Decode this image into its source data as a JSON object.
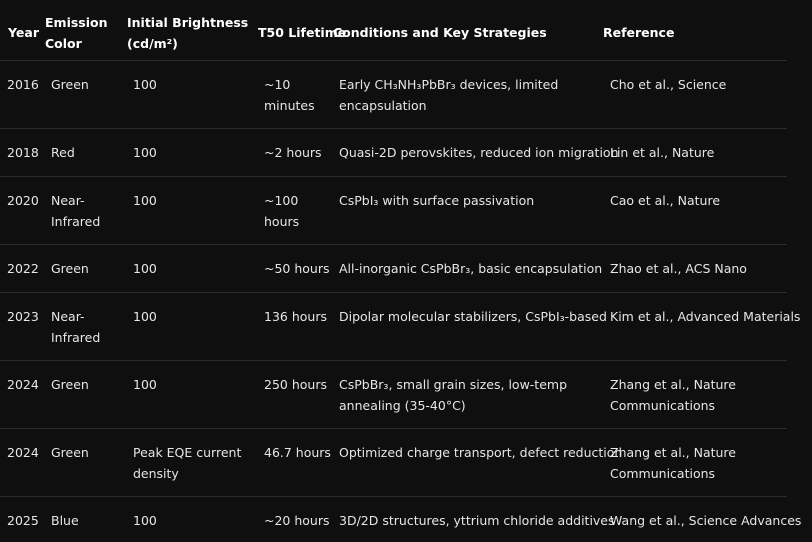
{
  "table": {
    "headers": {
      "year": "Year",
      "color": [
        "Emission",
        "Color"
      ],
      "brightness": [
        "Initial Brightness",
        "(cd/m²)"
      ],
      "t50": "T50 Lifetime",
      "conditions": "Conditions and Key Strategies",
      "reference": "Reference"
    },
    "rows": [
      {
        "year": "2016",
        "color": [
          "Green"
        ],
        "brightness": [
          "100"
        ],
        "t50": [
          "~10",
          "minutes"
        ],
        "conditions": [
          "Early CH₃NH₃PbBr₃ devices, limited",
          "encapsulation"
        ],
        "reference": [
          "Cho et al., Science"
        ]
      },
      {
        "year": "2018",
        "color": [
          "Red"
        ],
        "brightness": [
          "100"
        ],
        "t50": [
          "~2 hours"
        ],
        "conditions": [
          "Quasi-2D perovskites, reduced ion migration"
        ],
        "reference": [
          "Lin et al., Nature"
        ]
      },
      {
        "year": "2020",
        "color": [
          "Near-",
          "Infrared"
        ],
        "brightness": [
          "100"
        ],
        "t50": [
          "~100",
          "hours"
        ],
        "conditions": [
          "CsPbI₃ with surface passivation"
        ],
        "reference": [
          "Cao et al., Nature"
        ]
      },
      {
        "year": "2022",
        "color": [
          "Green"
        ],
        "brightness": [
          "100"
        ],
        "t50": [
          "~50 hours"
        ],
        "conditions": [
          "All-inorganic CsPbBr₃, basic encapsulation"
        ],
        "reference": [
          "Zhao et al., ACS Nano"
        ]
      },
      {
        "year": "2023",
        "color": [
          "Near-",
          "Infrared"
        ],
        "brightness": [
          "100"
        ],
        "t50": [
          "136 hours"
        ],
        "conditions": [
          "Dipolar molecular stabilizers, CsPbI₃-based"
        ],
        "reference": [
          "Kim et al., Advanced Materials"
        ]
      },
      {
        "year": "2024",
        "color": [
          "Green"
        ],
        "brightness": [
          "100"
        ],
        "t50": [
          "250 hours"
        ],
        "conditions": [
          "CsPbBr₃, small grain sizes, low-temp",
          "annealing (35-40°C)"
        ],
        "reference": [
          "Zhang et al., Nature",
          "Communications"
        ]
      },
      {
        "year": "2024",
        "color": [
          "Green"
        ],
        "brightness": [
          "Peak EQE current",
          "density"
        ],
        "t50": [
          "46.7 hours"
        ],
        "conditions": [
          "Optimized charge transport, defect reduction"
        ],
        "reference": [
          "Zhang et al., Nature",
          "Communications"
        ]
      },
      {
        "year": "2025",
        "color": [
          "Blue"
        ],
        "brightness": [
          "100"
        ],
        "t50": [
          "~20 hours"
        ],
        "conditions": [
          "3D/2D structures, yttrium chloride additives"
        ],
        "reference": [
          "Wang et al., Science Advances"
        ]
      }
    ]
  }
}
